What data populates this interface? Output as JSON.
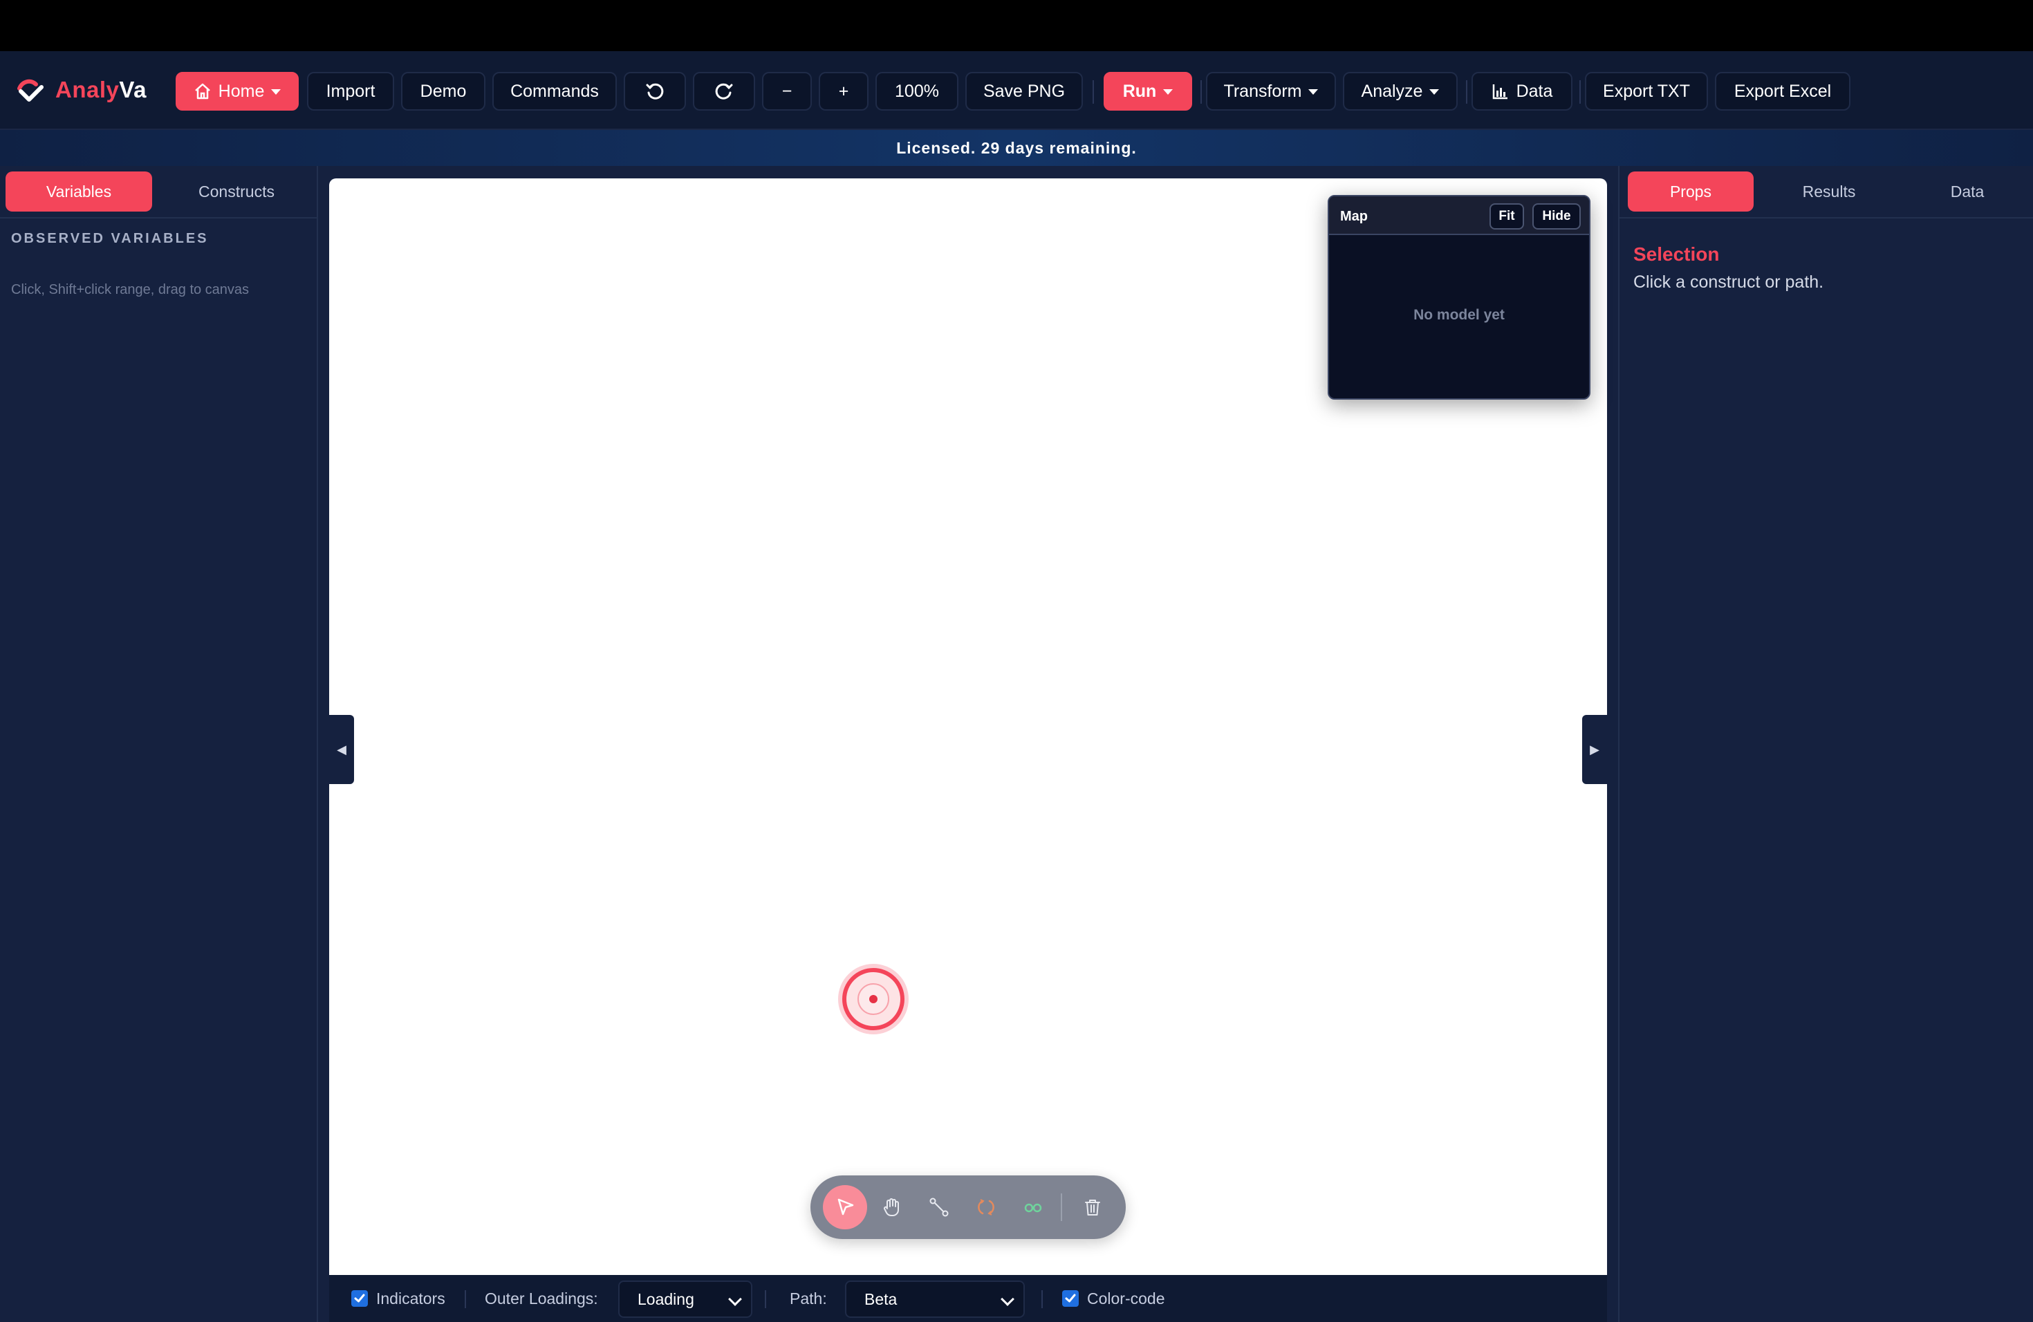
{
  "brand": {
    "name_part1": "Analy",
    "name_part2": "Va",
    "logo_icon": "analyva-logo-icon",
    "accent": "#f4455a"
  },
  "toolbar": {
    "home": "Home",
    "import": "Import",
    "demo": "Demo",
    "commands": "Commands",
    "undo_icon": "undo-icon",
    "redo_icon": "redo-icon",
    "zoom_out": "−",
    "zoom_in": "+",
    "zoom": "100%",
    "save_png": "Save PNG",
    "run": "Run",
    "transform": "Transform",
    "analyze": "Analyze",
    "data": "Data",
    "export_txt": "Export TXT",
    "export_excel": "Export Excel"
  },
  "license_banner": "Licensed. 29 days remaining.",
  "left_panel": {
    "tabs": [
      "Variables",
      "Constructs"
    ],
    "active_tab": "Variables",
    "section_title": "OBSERVED VARIABLES",
    "hint": "Click, Shift+click range, drag to canvas"
  },
  "minimap": {
    "title": "Map",
    "fit": "Fit",
    "hide": "Hide",
    "empty": "No model yet"
  },
  "canvas_tools": [
    "select-arrow-icon",
    "pan-hand-icon",
    "path-icon",
    "covariance-icon",
    "link-icon",
    "trash-icon"
  ],
  "bottom_bar": {
    "indicators_label": "Indicators",
    "indicators_checked": true,
    "outer_loadings_label": "Outer Loadings:",
    "outer_loadings_value": "Loading",
    "path_label": "Path:",
    "path_value": "Beta",
    "color_code_label": "Color-code",
    "color_code_checked": true
  },
  "right_panel": {
    "tabs": [
      "Props",
      "Results",
      "Data"
    ],
    "active_tab": "Props",
    "selection_title": "Selection",
    "selection_text": "Click a construct or path."
  },
  "side_toggles": {
    "left": "◀",
    "right": "▶"
  }
}
